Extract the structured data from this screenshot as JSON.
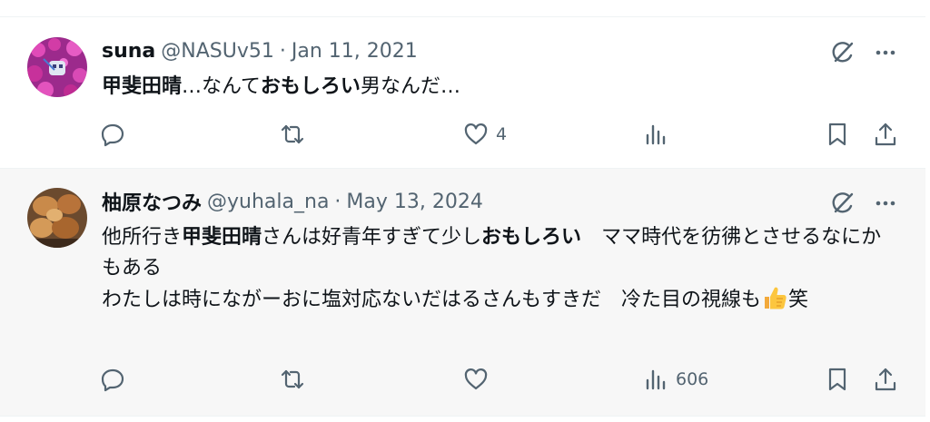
{
  "tweets": [
    {
      "name": "suna",
      "handle": "@NASUv51",
      "separator": "·",
      "date": "Jan 11, 2021",
      "text_segments": [
        {
          "text": "甲斐田晴",
          "bold": true
        },
        {
          "text": "…なんて",
          "bold": false
        },
        {
          "text": "おもしろい",
          "bold": true
        },
        {
          "text": "男なんだ…",
          "bold": false
        }
      ],
      "counts": {
        "reply": "",
        "retweet": "",
        "like": "4",
        "views": ""
      }
    },
    {
      "name": "柚原なつみ",
      "handle": "@yuhala_na",
      "separator": "·",
      "date": "May 13, 2024",
      "text_segments": [
        {
          "text": "他所行き",
          "bold": false
        },
        {
          "text": "甲斐田晴",
          "bold": true
        },
        {
          "text": "さんは好青年すぎて少し",
          "bold": false
        },
        {
          "text": "おもしろい",
          "bold": true
        },
        {
          "text": "　ママ時代を彷彿とさせるなにかもある\nわたしは時にながーおに塩対応ないだはるさんもすきだ　冷た目の視線も",
          "bold": false
        },
        {
          "emoji": "thumbs-up-emoji"
        },
        {
          "text": "笑",
          "bold": false
        }
      ],
      "counts": {
        "reply": "",
        "retweet": "",
        "like": "",
        "views": "606"
      }
    }
  ],
  "colors": {
    "text": "#0f1419",
    "muted": "#536471",
    "highlight_bg": "#f7f7f7",
    "divider": "#eff3f4"
  }
}
